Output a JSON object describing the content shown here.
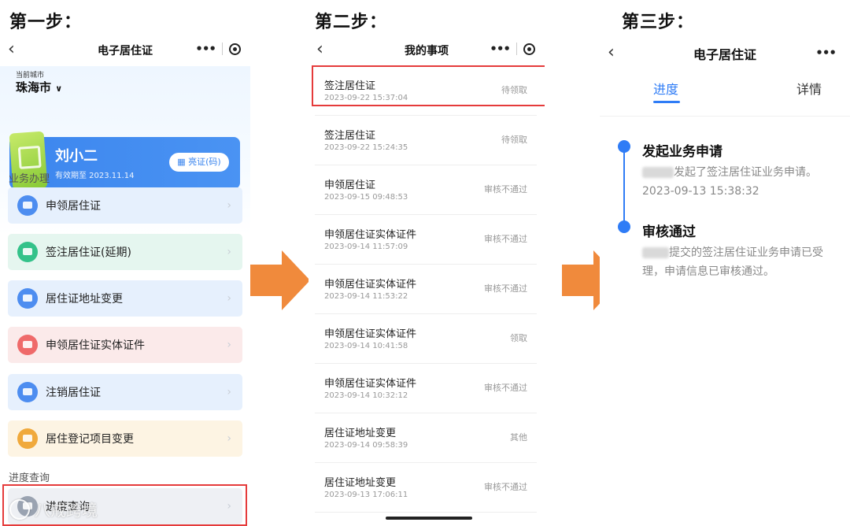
{
  "steps": [
    "第一步：",
    "第二步：",
    "第三步："
  ],
  "panel1": {
    "title": "电子居住证",
    "city_label": "当前城市",
    "city": "珠海市",
    "card": {
      "name": "刘小二",
      "valid": "有效期至 2023.11.14",
      "button": "亮证(码)"
    },
    "section_business": "业务办理",
    "menu": [
      {
        "label": "申领居住证",
        "icon": "id-card-icon",
        "bg": "#e6f0fd",
        "icon_color": "#4d8df0"
      },
      {
        "label": "签注居住证(延期)",
        "icon": "endorse-icon",
        "bg": "#e5f6ef",
        "icon_color": "#34c28a"
      },
      {
        "label": "居住证地址变更",
        "icon": "location-icon",
        "bg": "#e6f0fd",
        "icon_color": "#4d8df0"
      },
      {
        "label": "申领居住证实体证件",
        "icon": "card-icon",
        "bg": "#fbeaea",
        "icon_color": "#ef6a6a"
      },
      {
        "label": "注销居住证",
        "icon": "cancel-card-icon",
        "bg": "#e6f0fd",
        "icon_color": "#4d8df0"
      },
      {
        "label": "居住登记项目变更",
        "icon": "change-icon",
        "bg": "#fdf4e3",
        "icon_color": "#f0a93c"
      }
    ],
    "section_progress": "进度查询",
    "progress_item": "进度查询"
  },
  "panel2": {
    "title": "我的事项",
    "rows": [
      {
        "title": "签注居住证",
        "time": "2023-09-22 15:37:04",
        "status": "待领取"
      },
      {
        "title": "签注居住证",
        "time": "2023-09-22 15:24:35",
        "status": "待领取"
      },
      {
        "title": "申领居住证",
        "time": "2023-09-15 09:48:53",
        "status": "审核不通过"
      },
      {
        "title": "申领居住证实体证件",
        "time": "2023-09-14 11:57:09",
        "status": "审核不通过"
      },
      {
        "title": "申领居住证实体证件",
        "time": "2023-09-14 11:53:22",
        "status": "审核不通过"
      },
      {
        "title": "申领居住证实体证件",
        "time": "2023-09-14 10:41:58",
        "status": "领取"
      },
      {
        "title": "申领居住证实体证件",
        "time": "2023-09-14 10:32:12",
        "status": "审核不通过"
      },
      {
        "title": "居住证地址变更",
        "time": "2023-09-14 09:58:39",
        "status": "其他"
      },
      {
        "title": "居住证地址变更",
        "time": "2023-09-13 17:06:11",
        "status": "审核不通过"
      }
    ]
  },
  "panel3": {
    "title": "电子居住证",
    "tab_progress": "进度",
    "tab_detail": "详情",
    "timeline": [
      {
        "title": "发起业务申请",
        "text": "发起了签注居住证业务申请。",
        "time": "2023-09-13 15:38:32"
      },
      {
        "title": "审核通过",
        "text_a": "提交的签注居住证业务申请已受",
        "text_b": "理，申请信息已审核通过。"
      }
    ]
  },
  "watermark": "八戒跨境",
  "colors": {
    "accent": "#2f7cf6",
    "arrow": "#f08a3c",
    "highlight": "#e53b3b"
  }
}
